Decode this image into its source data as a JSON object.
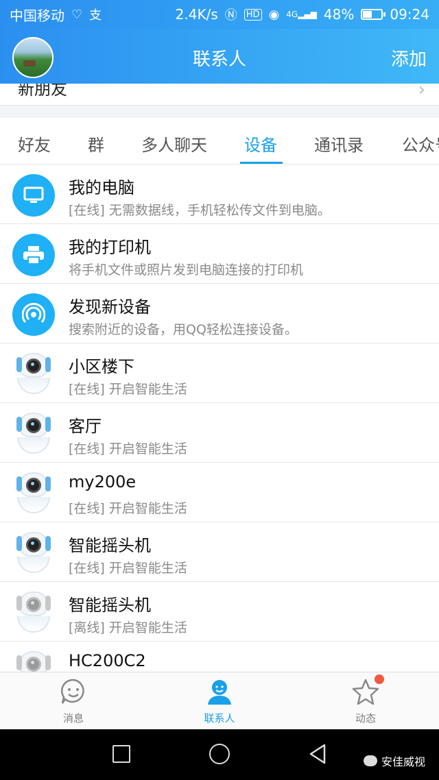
{
  "status_bar": {
    "carrier": "中国移动",
    "speed": "2.4K/s",
    "battery": "48%",
    "battery_level": 0.48,
    "time": "09:24",
    "network": "4G"
  },
  "header": {
    "title": "联系人",
    "add_label": "添加"
  },
  "new_friends": {
    "label": "新朋友"
  },
  "tabs": [
    {
      "label": "好友"
    },
    {
      "label": "群"
    },
    {
      "label": "多人聊天"
    },
    {
      "label": "设备",
      "active": true
    },
    {
      "label": "通讯录"
    },
    {
      "label": "公众号"
    }
  ],
  "devices": [
    {
      "name": "我的电脑",
      "desc": "[在线] 无需数据线，手机轻松传文件到电脑。",
      "icon": "computer-icon"
    },
    {
      "name": "我的打印机",
      "desc": "将手机文件或照片发到电脑连接的打印机",
      "icon": "printer-icon"
    },
    {
      "name": "发现新设备",
      "desc": "搜索附近的设备，用QQ轻松连接设备。",
      "icon": "signal-icon"
    },
    {
      "name": "小区楼下",
      "desc": "[在线] 开启智能生活",
      "icon": "camera-icon"
    },
    {
      "name": "客厅",
      "desc": "[在线] 开启智能生活",
      "icon": "camera-icon"
    },
    {
      "name": "my200e",
      "desc": "[在线] 开启智能生活",
      "icon": "camera-icon"
    },
    {
      "name": "智能摇头机",
      "desc": "[在线] 开启智能生活",
      "icon": "camera-icon"
    },
    {
      "name": "智能摇头机",
      "desc": "[离线] 开启智能生活",
      "icon": "camera-offline-icon"
    },
    {
      "name": "HC200C2",
      "desc": "",
      "icon": "camera-offline-icon"
    }
  ],
  "bottom_nav": [
    {
      "label": "消息",
      "icon": "smile-chat-icon"
    },
    {
      "label": "联系人",
      "icon": "contact-person-icon",
      "active": true
    },
    {
      "label": "动态",
      "icon": "star-icon",
      "badge": true
    }
  ],
  "watermark": "安佳威视",
  "colors": {
    "accent": "#1aa0e8",
    "header_start": "#2b8ff0",
    "header_end": "#40b8f7",
    "badge": "#f05a3a"
  }
}
